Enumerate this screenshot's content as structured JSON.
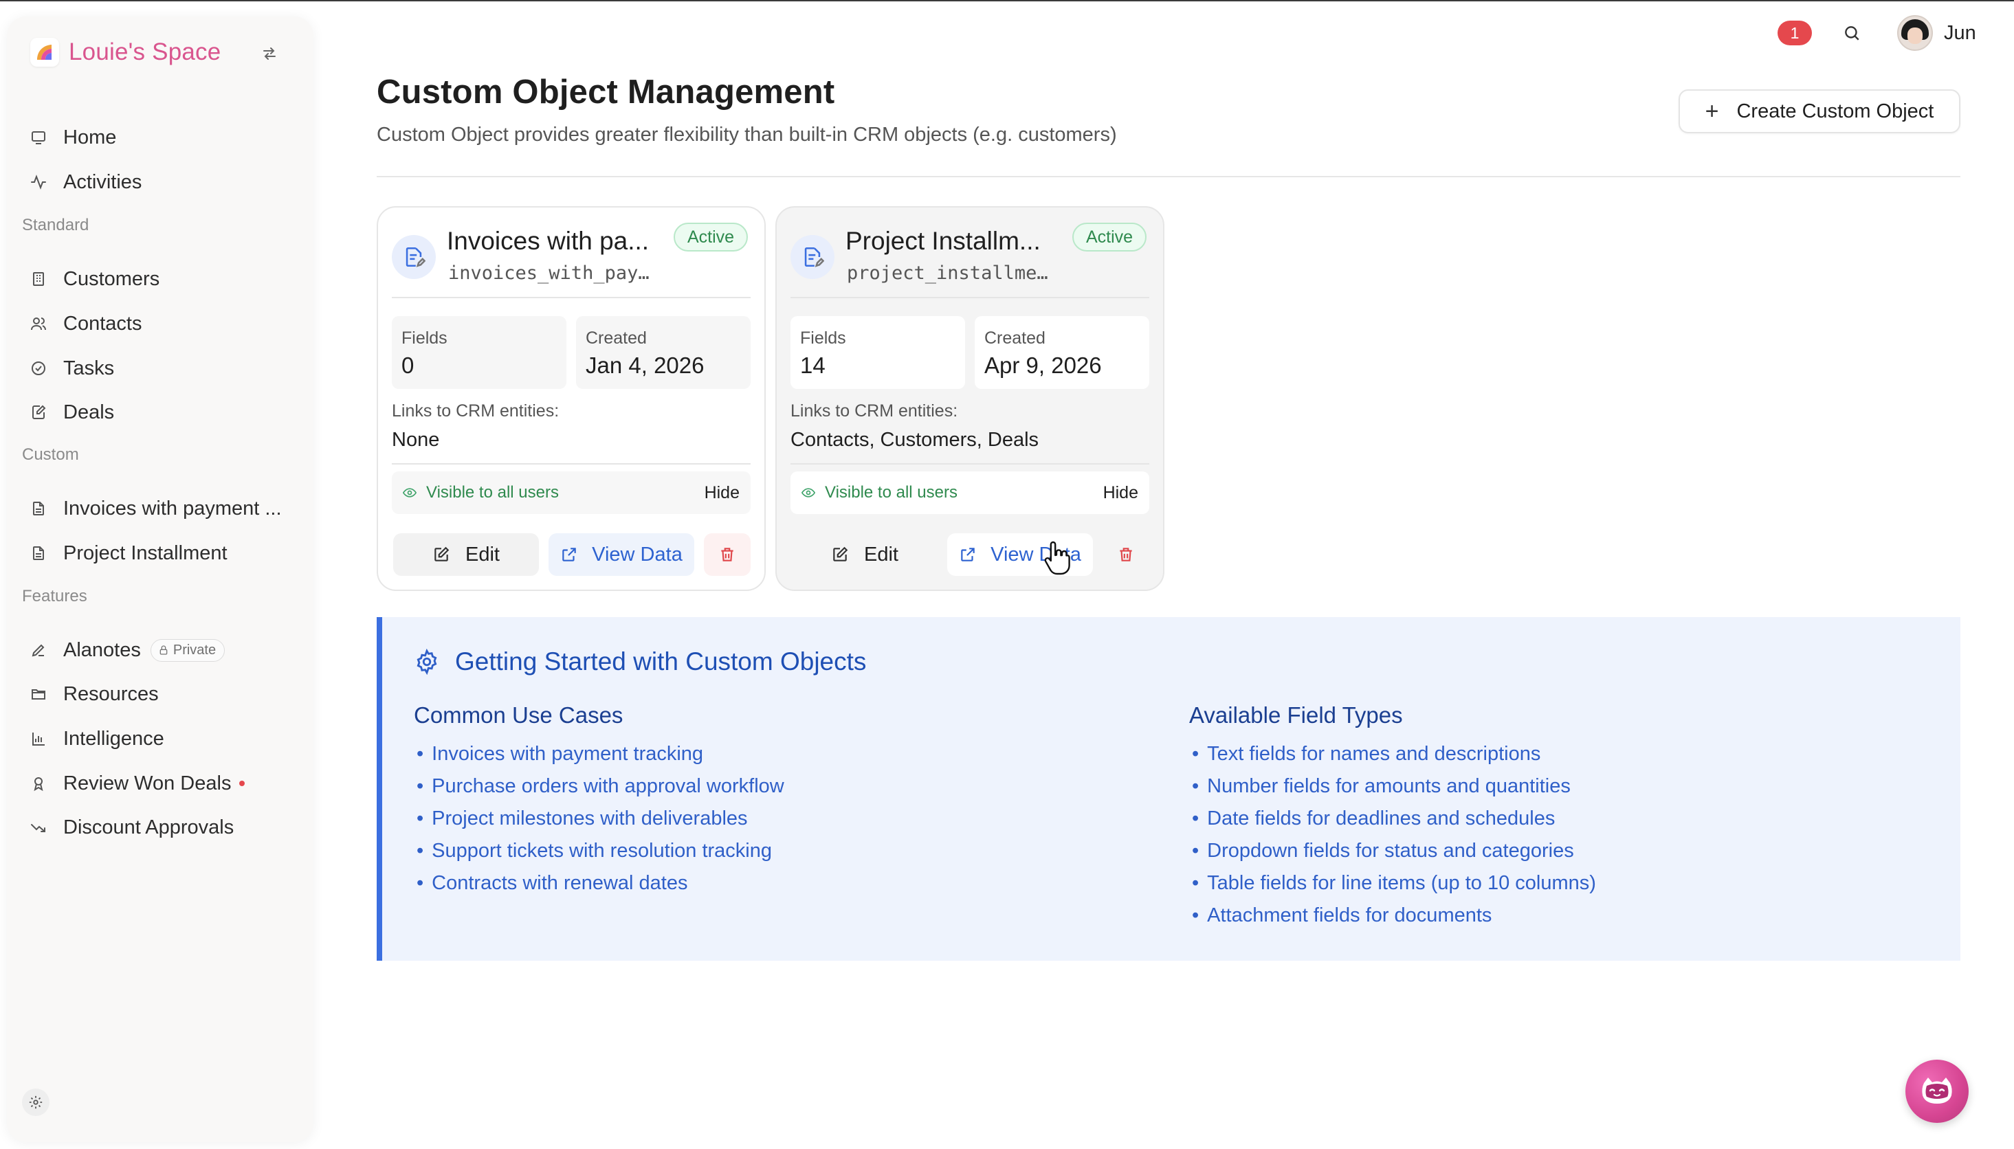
{
  "brand": {
    "name": "Louie's Space"
  },
  "sidebar": {
    "items": [
      {
        "label": "Home",
        "icon": "monitor-icon"
      },
      {
        "label": "Activities",
        "icon": "activity-icon"
      }
    ],
    "sections": [
      {
        "label": "Standard",
        "items": [
          {
            "label": "Customers",
            "icon": "building-icon"
          },
          {
            "label": "Contacts",
            "icon": "users-icon"
          },
          {
            "label": "Tasks",
            "icon": "check-circle-icon"
          },
          {
            "label": "Deals",
            "icon": "edit-doc-icon"
          }
        ]
      },
      {
        "label": "Custom",
        "items": [
          {
            "label": "Invoices with payment ...",
            "icon": "document-icon"
          },
          {
            "label": "Project Installment",
            "icon": "document-icon"
          }
        ]
      },
      {
        "label": "Features",
        "items": [
          {
            "label": "Alanotes",
            "icon": "pen-icon",
            "badge": "Private"
          },
          {
            "label": "Resources",
            "icon": "folder-icon"
          },
          {
            "label": "Intelligence",
            "icon": "bar-chart-icon"
          },
          {
            "label": "Review Won Deals",
            "icon": "award-icon"
          },
          {
            "label": "Discount Approvals",
            "icon": "trending-down-icon"
          }
        ]
      }
    ]
  },
  "topbar": {
    "notification_count": "1",
    "user_name": "Jun"
  },
  "header": {
    "title": "Custom Object Management",
    "subtitle": "Custom Object provides greater flexibility than built-in CRM objects (e.g. customers)",
    "create_label": "Create Custom Object"
  },
  "cards": [
    {
      "title": "Invoices with pa...",
      "key": "invoices_with_pay...",
      "status": "Active",
      "fields_label": "Fields",
      "fields_value": "0",
      "created_label": "Created",
      "created_value": "Jan 4, 2026",
      "links_label": "Links to CRM entities:",
      "links_value": "None",
      "visibility": "Visible to all users",
      "hide_label": "Hide",
      "edit_label": "Edit",
      "view_label": "View Data"
    },
    {
      "title": "Project Installm...",
      "key": "project_installme...",
      "status": "Active",
      "fields_label": "Fields",
      "fields_value": "14",
      "created_label": "Created",
      "created_value": "Apr 9, 2026",
      "links_label": "Links to CRM entities:",
      "links_value": "Contacts, Customers, Deals",
      "visibility": "Visible to all users",
      "hide_label": "Hide",
      "edit_label": "Edit",
      "view_label": "View Data"
    }
  ],
  "getting_started": {
    "title": "Getting Started with Custom Objects",
    "use_cases_title": "Common Use Cases",
    "use_cases": [
      "Invoices with payment tracking",
      "Purchase orders with approval workflow",
      "Project milestones with deliverables",
      "Support tickets with resolution tracking",
      "Contracts with renewal dates"
    ],
    "field_types_title": "Available Field Types",
    "field_types": [
      "Text fields for names and descriptions",
      "Number fields for amounts and quantities",
      "Date fields for deadlines and schedules",
      "Dropdown fields for status and categories",
      "Table fields for line items (up to 10 columns)",
      "Attachment fields for documents"
    ]
  },
  "colors": {
    "brand": "#d9558e",
    "accent": "#2d62d0",
    "active": "#2f8a4e",
    "danger": "#e0464a",
    "panel": "#eef3fd"
  }
}
